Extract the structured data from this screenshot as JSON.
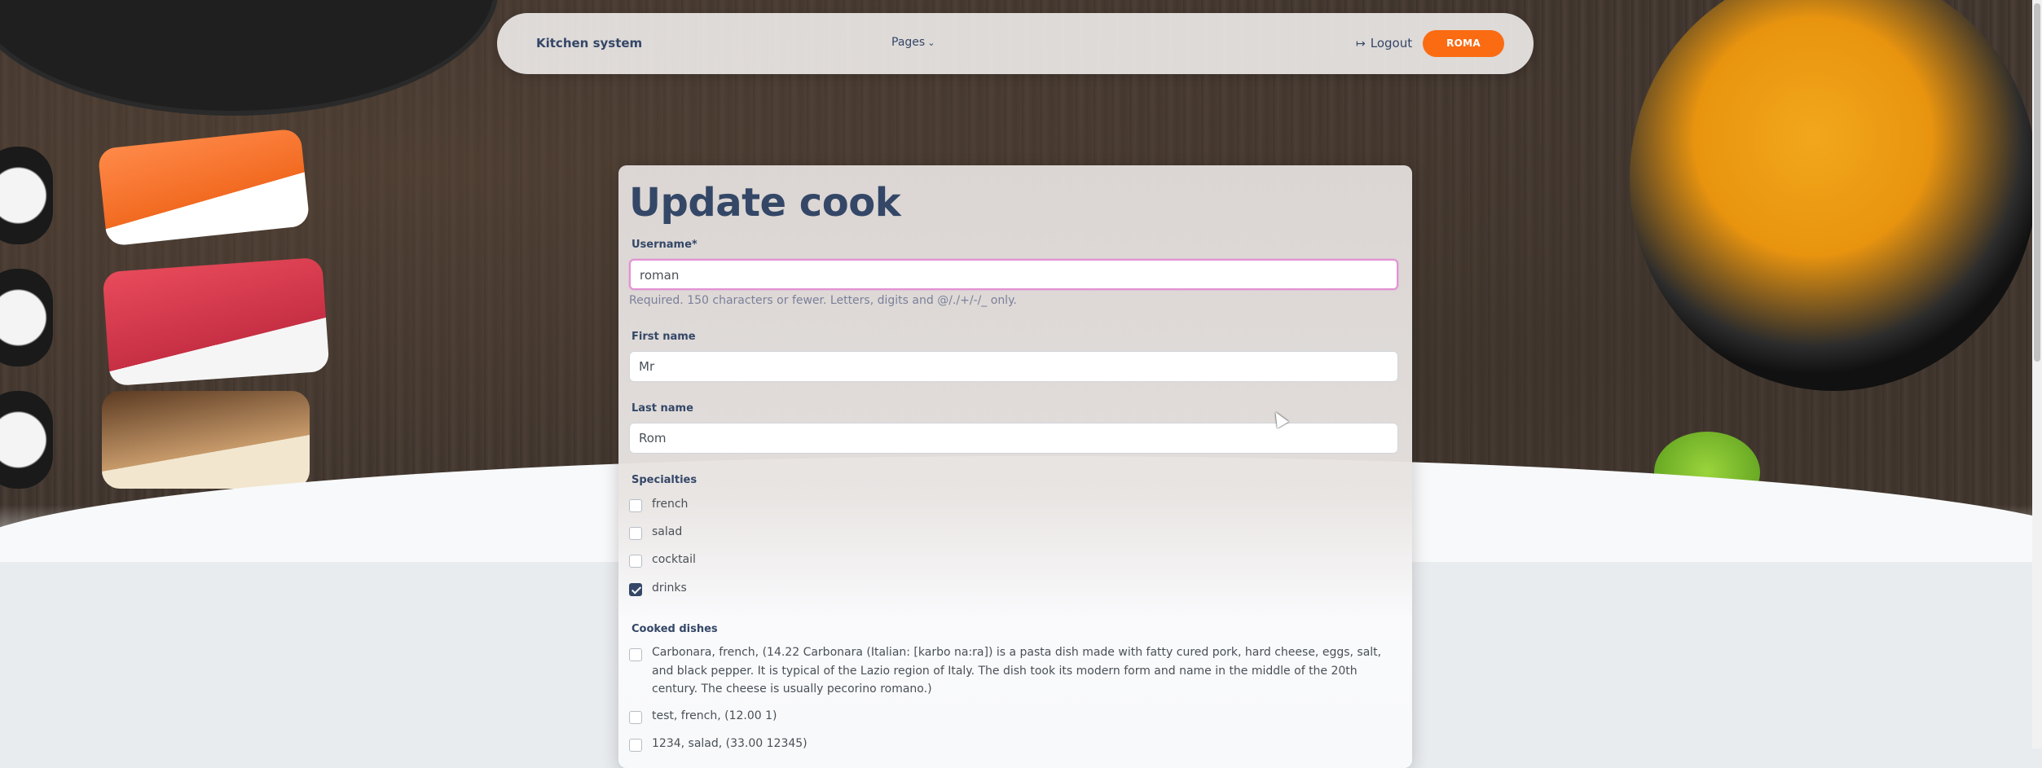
{
  "navbar": {
    "brand": "Kitchen system",
    "pages_label": "Pages",
    "logout_label": "Logout",
    "user_button_label": "ROMA"
  },
  "form": {
    "title": "Update cook",
    "username": {
      "label": "Username*",
      "value": "roman",
      "help": "Required. 150 characters or fewer. Letters, digits and @/./+/-/_ only."
    },
    "first_name": {
      "label": "First name",
      "value": "Mr"
    },
    "last_name": {
      "label": "Last name",
      "value": "Rom"
    },
    "specialties": {
      "label": "Specialties",
      "options": [
        {
          "label": "french",
          "checked": false
        },
        {
          "label": "salad",
          "checked": false
        },
        {
          "label": "cocktail",
          "checked": false
        },
        {
          "label": "drinks",
          "checked": true
        }
      ]
    },
    "cooked_dishes": {
      "label": "Cooked dishes",
      "options": [
        {
          "label": "Carbonara, french, (14.22 Carbonara (Italian: [karbo na:ra]) is a pasta dish made with fatty cured pork, hard cheese, eggs, salt, and black pepper. It is typical of the Lazio region of Italy. The dish took its modern form and name in the middle of the 20th century. The cheese is usually pecorino romano.)",
          "checked": false
        },
        {
          "label": "test, french, (12.00 1)",
          "checked": false
        },
        {
          "label": "1234, salad, (33.00 12345)",
          "checked": false
        }
      ]
    }
  },
  "colors": {
    "accent": "#fb6b12",
    "text": "#344767",
    "focus_border": "#e293d3"
  }
}
